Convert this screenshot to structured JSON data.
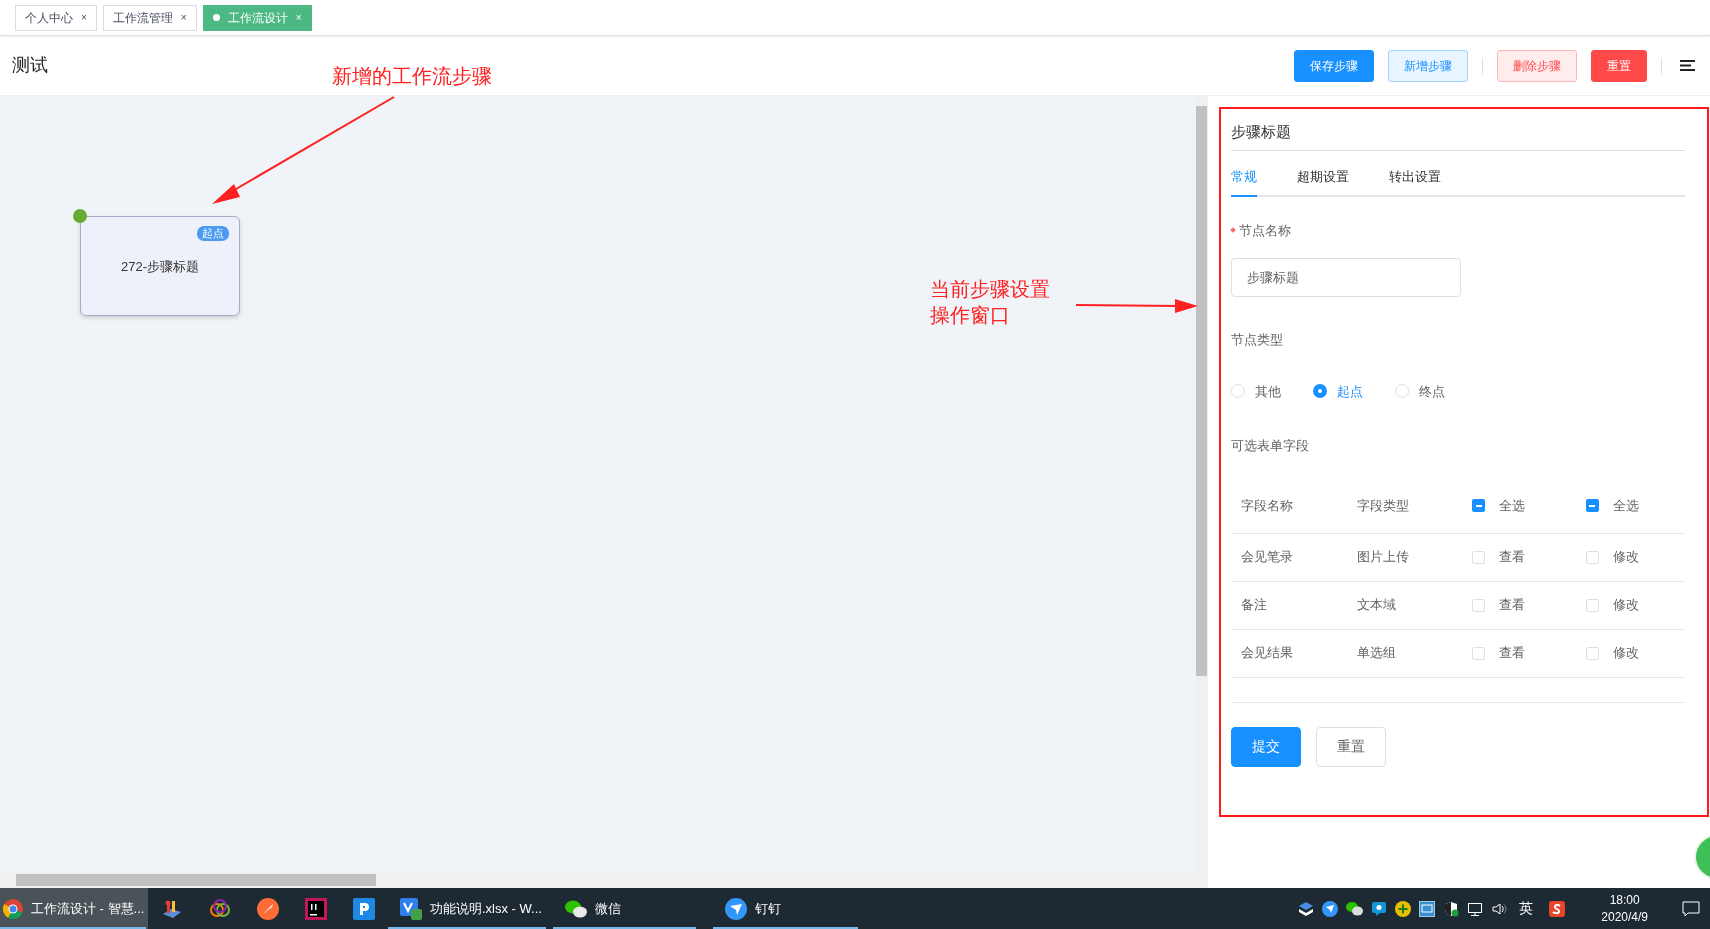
{
  "top_tabs": [
    {
      "label": "个人中心",
      "close": "×",
      "selected": false
    },
    {
      "label": "工作流管理",
      "close": "×",
      "selected": false
    },
    {
      "label": "工作流设计",
      "close": "×",
      "selected": true
    }
  ],
  "page_title": "测试",
  "toolbar": [
    {
      "label": "保存步骤",
      "kind": "primary"
    },
    {
      "label": "新增步骤",
      "kind": "plain"
    },
    {
      "kind": "divider"
    },
    {
      "label": "删除步骤",
      "kind": "danger-plain"
    },
    {
      "label": "重置",
      "kind": "danger"
    },
    {
      "kind": "divider"
    }
  ],
  "canvas": {
    "nodes": [
      {
        "badge": "起点",
        "label": "272-步骤标题"
      }
    ]
  },
  "annotations": [
    {
      "lines": [
        "新增的工作流步骤"
      ],
      "kind": "node-note"
    },
    {
      "lines": [
        "当前步骤设置",
        "操作窗口"
      ],
      "kind": "panel-note"
    }
  ],
  "panel": {
    "title": "步骤标题",
    "tabs": [
      {
        "label": "常规",
        "selected": true
      },
      {
        "label": "超期设置",
        "selected": false
      },
      {
        "label": "转出设置",
        "selected": false
      }
    ],
    "name_field": {
      "label": "节点名称",
      "required": true,
      "value": "步骤标题"
    },
    "type_field": {
      "label": "节点类型",
      "options": [
        {
          "label": "其他",
          "selected": false
        },
        {
          "label": "起点",
          "selected": true
        },
        {
          "label": "终点",
          "selected": false
        }
      ]
    },
    "fields_section": {
      "label": "可选表单字段",
      "columns": [
        {
          "label": "字段名称"
        },
        {
          "label": "字段类型"
        },
        {
          "label": "全选",
          "indeterminate": true
        },
        {
          "label": "全选",
          "indeterminate": true
        }
      ],
      "rows": [
        {
          "name": "会见笔录",
          "type": "图片上传",
          "view": {
            "label": "查看",
            "checked": false
          },
          "edit": {
            "label": "修改",
            "checked": false
          }
        },
        {
          "name": "备注",
          "type": "文本域",
          "view": {
            "label": "查看",
            "checked": false
          },
          "edit": {
            "label": "修改",
            "checked": false
          }
        },
        {
          "name": "会见结果",
          "type": "单选组",
          "view": {
            "label": "查看",
            "checked": false
          },
          "edit": {
            "label": "修改",
            "checked": false
          }
        }
      ]
    },
    "buttons": [
      {
        "label": "提交",
        "kind": "primary"
      },
      {
        "label": "重置",
        "kind": "plain"
      }
    ]
  },
  "taskbar": {
    "apps": [
      {
        "label": "工作流设计 - 智慧...",
        "selected": true,
        "running": false
      },
      {
        "selected": false,
        "running": false
      },
      {
        "selected": false,
        "running": false
      },
      {
        "selected": false,
        "running": false
      },
      {
        "selected": false,
        "running": false
      },
      {
        "selected": false,
        "running": false
      },
      {
        "label": "功能说明.xlsx - W...",
        "selected": false,
        "running": true
      },
      {
        "label": "微信",
        "selected": false,
        "running": true
      },
      {
        "label": "钉钉",
        "selected": false,
        "running": true
      }
    ],
    "language": "英",
    "time": "18:00",
    "date": "2020/4/9"
  }
}
